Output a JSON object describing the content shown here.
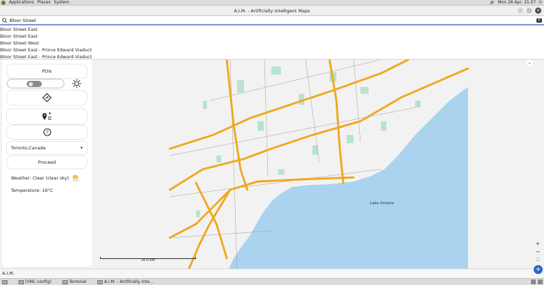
{
  "desktop": {
    "menu": [
      "Applications",
      "Places",
      "System"
    ],
    "clock": "Mon 28 Apr, 21:07"
  },
  "window": {
    "title": "A.I.M. - Artificially Intelligent Maps"
  },
  "search": {
    "value": "Bloor Street"
  },
  "suggestions": [
    "Bloor Street East",
    "Bloor Street East",
    "Bloor Street West",
    "Bloor Street East - Prince Edward Viaduct",
    "Bloor Street East - Prince Edward Viaduct"
  ],
  "sidebar": {
    "pois_label": "POIs",
    "location": "Toronto,Canada",
    "proceed_label": "Proceed",
    "weather": "Weather: Clear (clear sky)",
    "temperature": "Temperature: 16°C"
  },
  "map": {
    "lake_label": "Lake Ontario",
    "scale_label": "20.0 km",
    "colors": {
      "water": "#aad3f0",
      "land": "#f2f2f2",
      "roads": "#f0a81f",
      "parks": "#b8e3cf"
    }
  },
  "status": {
    "text": "A.I.M."
  },
  "taskbar": {
    "tasks": [
      "[VNC config]",
      "Terminal",
      "A.I.M. - Artificially Inte..."
    ]
  }
}
